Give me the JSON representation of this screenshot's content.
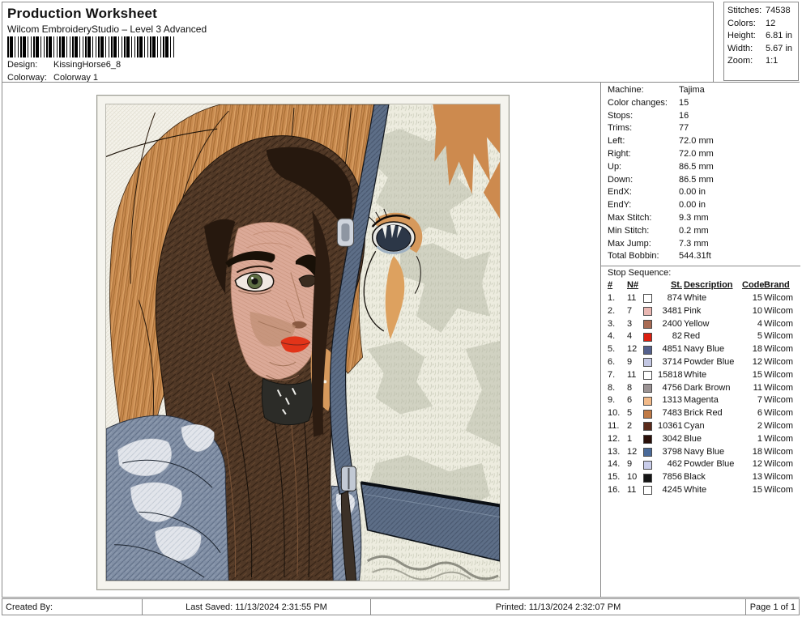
{
  "header": {
    "title": "Production Worksheet",
    "subtitle": "Wilcom EmbroideryStudio – Level 3 Advanced",
    "design_label": "Design:",
    "design_value": "KissingHorse6_8",
    "colorway_label": "Colorway:",
    "colorway_value": "Colorway 1",
    "barcode_icon": "barcode-image"
  },
  "summary": {
    "rows": [
      {
        "label": "Stitches:",
        "value": "74538"
      },
      {
        "label": "Colors:",
        "value": "12"
      },
      {
        "label": "Height:",
        "value": "6.81 in"
      },
      {
        "label": "Width:",
        "value": "5.67 in"
      },
      {
        "label": "Zoom:",
        "value": "1:1"
      }
    ]
  },
  "machine_info": {
    "rows": [
      {
        "label": "Machine:",
        "value": "Tajima"
      },
      {
        "label": "Color changes:",
        "value": "15"
      },
      {
        "label": "Stops:",
        "value": "16"
      },
      {
        "label": "Trims:",
        "value": "77"
      },
      {
        "label": "Left:",
        "value": "72.0 mm"
      },
      {
        "label": "Right:",
        "value": "72.0 mm"
      },
      {
        "label": "Up:",
        "value": "86.5 mm"
      },
      {
        "label": "Down:",
        "value": "86.5 mm"
      },
      {
        "label": "EndX:",
        "value": "0.00 in"
      },
      {
        "label": "EndY:",
        "value": "0.00 in"
      },
      {
        "label": "Max Stitch:",
        "value": "9.3 mm"
      },
      {
        "label": "Min Stitch:",
        "value": "0.2 mm"
      },
      {
        "label": "Max Jump:",
        "value": "7.3 mm"
      },
      {
        "label": "Total Bobbin:",
        "value": "544.31ft"
      }
    ]
  },
  "stop_sequence": {
    "title": "Stop Sequence:",
    "columns": [
      "#",
      "N#",
      "",
      "St.",
      "Description",
      "Code",
      "Brand"
    ],
    "rows": [
      {
        "num": "1.",
        "n": "11",
        "color": "#ffffff",
        "st": "874",
        "description": "White",
        "code": "15",
        "brand": "Wilcom"
      },
      {
        "num": "2.",
        "n": "7",
        "color": "#e9b7b2",
        "st": "3481",
        "description": "Pink",
        "code": "10",
        "brand": "Wilcom"
      },
      {
        "num": "3.",
        "n": "3",
        "color": "#a86b53",
        "st": "2400",
        "description": "Yellow",
        "code": "4",
        "brand": "Wilcom"
      },
      {
        "num": "4.",
        "n": "4",
        "color": "#dc1f10",
        "st": "82",
        "description": "Red",
        "code": "5",
        "brand": "Wilcom"
      },
      {
        "num": "5.",
        "n": "12",
        "color": "#55618d",
        "st": "4851",
        "description": "Navy Blue",
        "code": "18",
        "brand": "Wilcom"
      },
      {
        "num": "6.",
        "n": "9",
        "color": "#c3c7e3",
        "st": "3714",
        "description": "Powder Blue",
        "code": "12",
        "brand": "Wilcom"
      },
      {
        "num": "7.",
        "n": "11",
        "color": "#ffffff",
        "st": "15818",
        "description": "White",
        "code": "15",
        "brand": "Wilcom"
      },
      {
        "num": "8.",
        "n": "8",
        "color": "#9b9394",
        "st": "4756",
        "description": "Dark Brown",
        "code": "11",
        "brand": "Wilcom"
      },
      {
        "num": "9.",
        "n": "6",
        "color": "#f2ba89",
        "st": "1313",
        "description": "Magenta",
        "code": "7",
        "brand": "Wilcom"
      },
      {
        "num": "10.",
        "n": "5",
        "color": "#c07a45",
        "st": "7483",
        "description": "Brick Red",
        "code": "6",
        "brand": "Wilcom"
      },
      {
        "num": "11.",
        "n": "2",
        "color": "#5a2a1a",
        "st": "10361",
        "description": "Cyan",
        "code": "2",
        "brand": "Wilcom"
      },
      {
        "num": "12.",
        "n": "1",
        "color": "#2a100a",
        "st": "3042",
        "description": "Blue",
        "code": "1",
        "brand": "Wilcom"
      },
      {
        "num": "13.",
        "n": "12",
        "color": "#4a6a99",
        "st": "3798",
        "description": "Navy Blue",
        "code": "18",
        "brand": "Wilcom"
      },
      {
        "num": "14.",
        "n": "9",
        "color": "#c9cdea",
        "st": "462",
        "description": "Powder Blue",
        "code": "12",
        "brand": "Wilcom"
      },
      {
        "num": "15.",
        "n": "10",
        "color": "#151515",
        "st": "7856",
        "description": "Black",
        "code": "13",
        "brand": "Wilcom"
      },
      {
        "num": "16.",
        "n": "11",
        "color": "#ffffff",
        "st": "4245",
        "description": "White",
        "code": "15",
        "brand": "Wilcom"
      }
    ]
  },
  "footer": {
    "created_by": "Created By:",
    "last_saved": "Last Saved: 11/13/2024 2:31:55 PM",
    "printed": "Printed: 11/13/2024 2:32:07 PM",
    "page": "Page 1 of 1"
  },
  "artwork": {
    "description": "Embroidered portrait of a woman with long dark brown hair beside a white horse with a chestnut mane and slate-blue bridle",
    "palette": {
      "mane_orange": "#c98b50",
      "fur_white": "#edecdf",
      "hair_brown": "#503826",
      "skin": "#d9a795",
      "lips_red": "#e23419",
      "jacket_denim": "#8290a6",
      "bridle_slate": "#5c6d86",
      "eye_navy": "#2c3747"
    }
  }
}
